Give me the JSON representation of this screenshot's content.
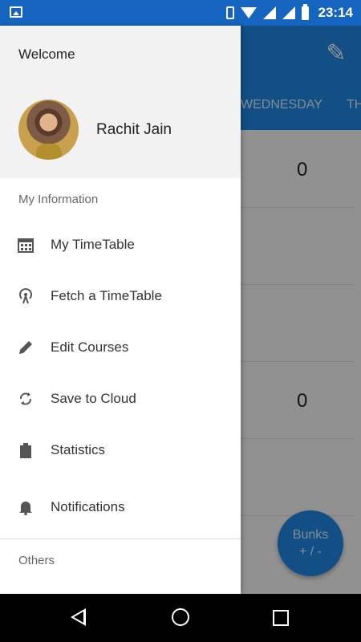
{
  "status_bar": {
    "time": "23:14"
  },
  "background": {
    "tabs": [
      "WEDNESDAY",
      "TH"
    ],
    "rows": [
      "0",
      "",
      "",
      "0",
      ""
    ],
    "fab": {
      "line1": "Bunks",
      "line2": "+ / -"
    }
  },
  "drawer": {
    "welcome": "Welcome",
    "user_name": "Rachit Jain",
    "section_my_info": "My Information",
    "items": [
      {
        "label": "My TimeTable",
        "icon": "calendar-icon"
      },
      {
        "label": "Fetch a TimeTable",
        "icon": "broadcast-icon"
      },
      {
        "label": "Edit Courses",
        "icon": "pencil-icon"
      },
      {
        "label": "Save to Cloud",
        "icon": "sync-icon"
      },
      {
        "label": "Statistics",
        "icon": "clipboard-icon"
      },
      {
        "label": "Notifications",
        "icon": "bell-icon"
      }
    ],
    "section_others": "Others"
  },
  "colors": {
    "status_bar": "#1565c0",
    "toolbar": "#1e88e5",
    "drawer_header": "#f2f2f2"
  }
}
